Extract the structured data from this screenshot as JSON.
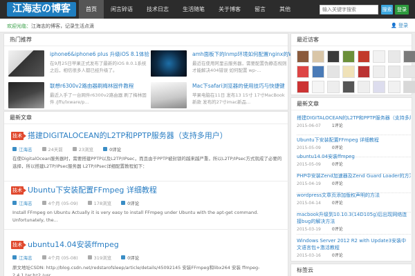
{
  "header": {
    "logo": "江海志の博客",
    "nav": [
      "首页",
      "闲言碎语",
      "技术日志",
      "生活随笔",
      "关于博客",
      "留言",
      "其他"
    ],
    "search_placeholder": "输入关键字搜索",
    "search_label": "搜索",
    "login_label": "登录"
  },
  "notice": {
    "highlight": "欢迎光临：",
    "text": "江海志的博客，记录生活点滴",
    "user": "登录"
  },
  "featured": {
    "title": "热门推荐",
    "items": [
      {
        "title": "iphone6&iphone6 plus 升级iOS 8.1体验",
        "desc": "在9月25日苹果正式发布了最新的iOS 8.0.1系统之后，相信很多人都已经升级了。"
      },
      {
        "title": "amh面板下的lnmp环境如何配置nginx的WordPress",
        "desc": "最近在使用阿里云服务器，需要配置伪静态规则才能解决404错误 如何配置 wp-..."
      },
      {
        "title": "联想r6300v2路由器刷梅林固件教程",
        "desc": "最近入手了一台网件r6300v2路由器 刷了梅林固件 /jffs/lxware/p..."
      },
      {
        "title": "Mac下safari浏览器的使用技巧与快捷键",
        "desc": "苹果电脑在11日 发布13 15寸 17寸MacBook 新款 发布的27寸imac新品..."
      }
    ]
  },
  "latest": {
    "title": "最新文章",
    "articles": [
      {
        "category": "技术",
        "title": "搭建DIGITALOCEAN的L2TP和PPTP服务器（支持多用户）",
        "author": "江海志",
        "date": "24天前",
        "views": "23浏览",
        "comments": "0评论",
        "excerpt": "在使DigitalOcean服务器时，需要搭建PPTP以及L2TP/IPsec，而且由于PPTP被封锁的越来越严重，所以L2TP/IPsec方式就成了必要的选择，所以搭建L2TP/IPsec服务器 L2TP/IPsec详细配置教程如下："
      },
      {
        "category": "技术",
        "title": "Ubuntu下安装配置FFmpeg 详细教程",
        "author": "江海志",
        "date": "4个月 (05-09)",
        "views": "178浏览",
        "comments": "0评论",
        "excerpt": "Install FFmpeg on Ubuntu Actually it is very easy to install FFmpeg under Ubuntu with the apt-get command. Unfortunately, the..."
      },
      {
        "category": "技术",
        "title": "ubuntu14.04安装ffmpeg",
        "author": "江海志",
        "date": "4个月 (05-08)",
        "views": "319浏览",
        "comments": "0评论",
        "excerpt": "原文地址CSDN: http://blog.csdn.net/redstarofsleep/article/details/45092145   安装FFmpeg和libx264 安装 ffmpeg-2.4.1.tar.bz2 /usr..."
      }
    ]
  },
  "sidebar": {
    "visitors_title": "最近访客",
    "visitor_count": 24,
    "newest_title": "最新文章",
    "newest": [
      {
        "title": "搭建DIGITALOCEAN的L2TP和PPTP服务器（支持多用户）",
        "date": "2015-06-07",
        "comments": "1评论"
      },
      {
        "title": "Ubuntu下安装配置FFmpeg 详细教程",
        "date": "2015-05-09",
        "comments": "0评论"
      },
      {
        "title": "ubuntu14.04安装ffmpeg",
        "date": "2015-05-09",
        "comments": "0评论"
      },
      {
        "title": "PHP中安装Zend加速器及Zend Guard Loader的方法",
        "date": "2015-04-19",
        "comments": "0评论"
      },
      {
        "title": "wordpress文章页添加版权声明的方法",
        "date": "2015-04-14",
        "comments": "0评论"
      },
      {
        "title": "macbook升级到10.10.3(14D105g)后出现网络连接bug的解决方法",
        "date": "2015-03-19",
        "comments": "0评论"
      },
      {
        "title": "Windows Server 2012 R2 with Update3安装中文语言包+激活教程",
        "date": "2015-03-16",
        "comments": "0评论"
      }
    ],
    "bottom_title": "标签云"
  },
  "colors": {
    "topbar": "#2c2c2c",
    "logo": "#1f7ec0",
    "link": "#2a7ec3",
    "badge": "#e0492e",
    "search": "#3da7de",
    "login": "#2d9a3d"
  }
}
